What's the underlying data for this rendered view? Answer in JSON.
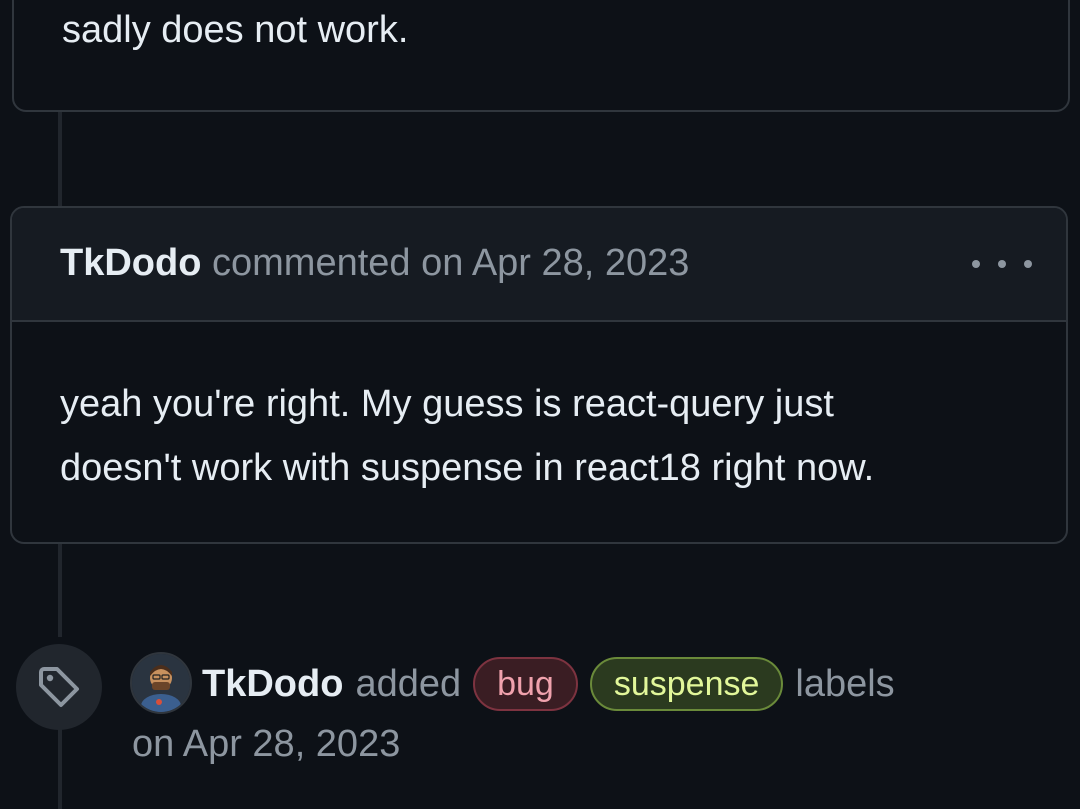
{
  "previous_comment": {
    "body_tail": "sadly does not work."
  },
  "comment": {
    "author": "TkDodo",
    "action": "commented on Apr 28, 2023",
    "menu_icon": "kebab-horizontal-icon",
    "body_line1": "yeah you're right. My guess is react-query just",
    "body_line2": "doesn't work with suspense in react18 right now."
  },
  "label_event": {
    "icon": "tag-icon",
    "actor": "TkDodo",
    "verb": "added",
    "labels": [
      {
        "name": "bug",
        "color": "#f0a2ad"
      },
      {
        "name": "suspense",
        "color": "#e2f79a"
      }
    ],
    "suffix": "labels",
    "timestamp": "on Apr 28, 2023"
  },
  "colors": {
    "background": "#0d1117",
    "header_background": "#161b22",
    "border": "#30363d",
    "muted_text": "#8d96a0"
  }
}
